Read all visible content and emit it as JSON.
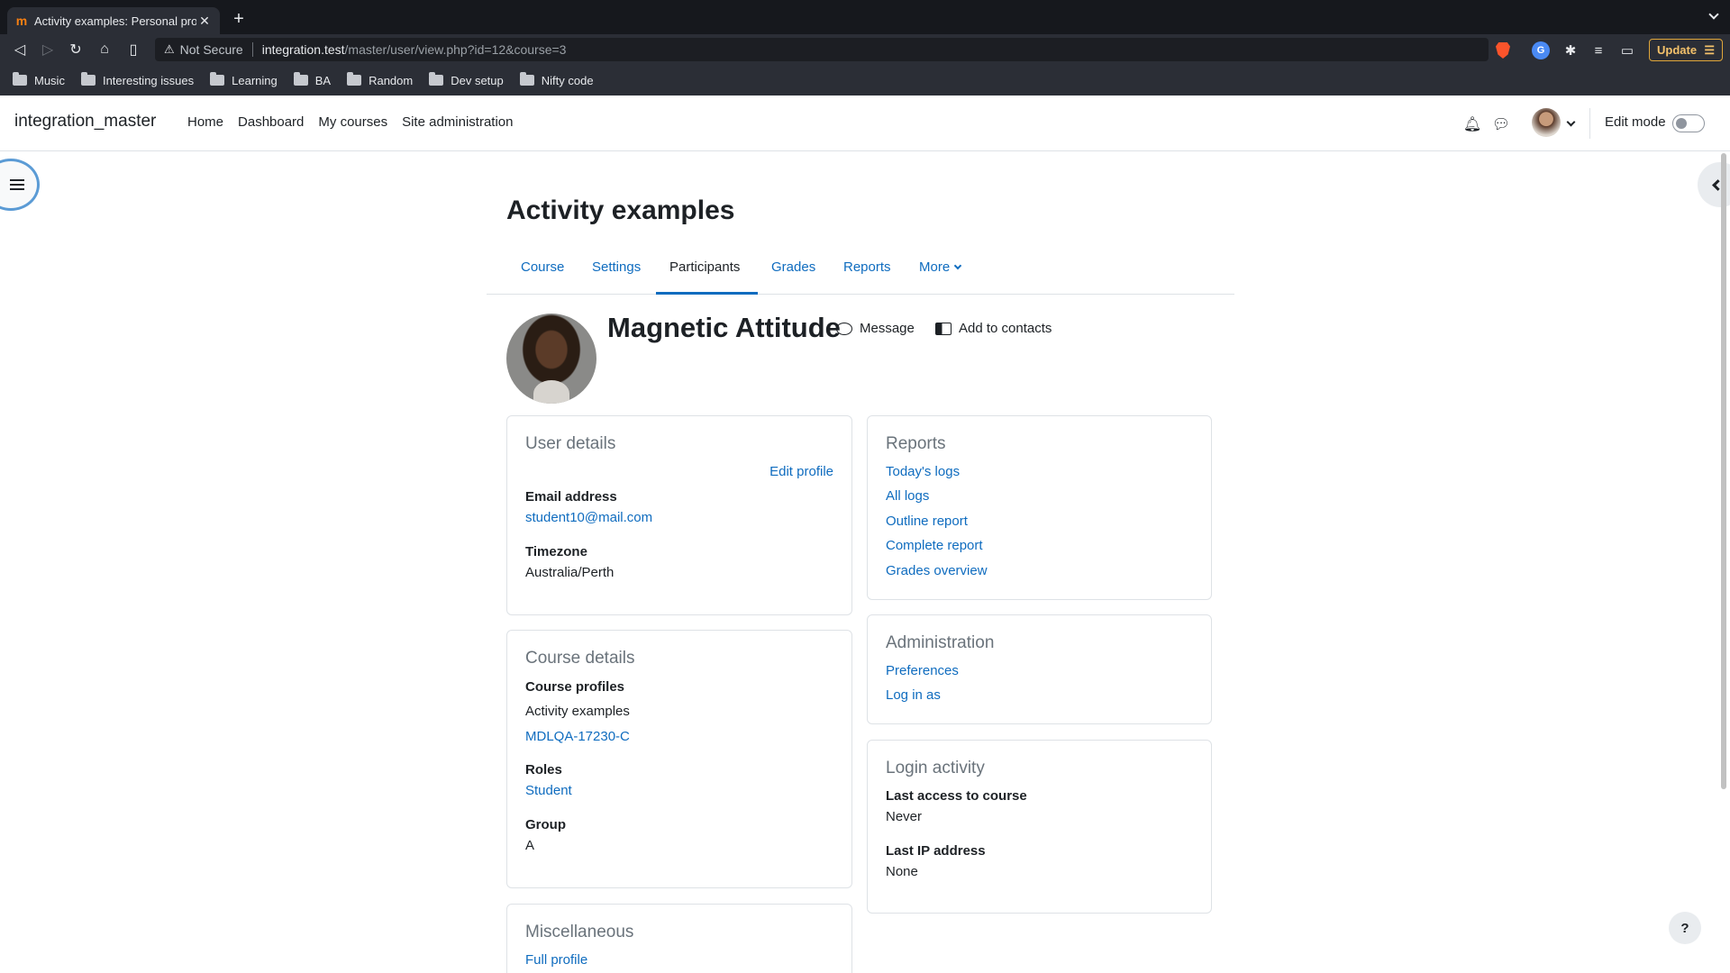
{
  "browser": {
    "tab_title": "Activity examples: Personal pro",
    "tab_favicon": "m",
    "not_secure": "Not Secure",
    "url_host": "integration.test",
    "url_path": "/master/user/view.php?id=12&course=3",
    "update_label": "Update",
    "bookmarks": [
      "Music",
      "Interesting issues",
      "Learning",
      "BA",
      "Random",
      "Dev setup",
      "Nifty code"
    ]
  },
  "site": {
    "brand": "integration_master",
    "nav": [
      "Home",
      "Dashboard",
      "My courses",
      "Site administration"
    ],
    "edit_mode_label": "Edit mode"
  },
  "page": {
    "title": "Activity examples",
    "tabs": [
      "Course",
      "Settings",
      "Participants",
      "Grades",
      "Reports",
      "More"
    ],
    "user_name": "Magnetic Attitude",
    "message_label": "Message",
    "add_contacts_label": "Add to contacts"
  },
  "user_details": {
    "heading": "User details",
    "edit_profile": "Edit profile",
    "email_label": "Email address",
    "email_value": "student10@mail.com",
    "timezone_label": "Timezone",
    "timezone_value": "Australia/Perth"
  },
  "course_details": {
    "heading": "Course details",
    "profiles_label": "Course profiles",
    "profile_1": "Activity examples",
    "profile_2": "MDLQA-17230-C",
    "roles_label": "Roles",
    "roles_value": "Student",
    "group_label": "Group",
    "group_value": "A"
  },
  "misc": {
    "heading": "Miscellaneous",
    "full_profile": "Full profile"
  },
  "reports": {
    "heading": "Reports",
    "links": [
      "Today's logs",
      "All logs",
      "Outline report",
      "Complete report",
      "Grades overview"
    ]
  },
  "administration": {
    "heading": "Administration",
    "links": [
      "Preferences",
      "Log in as"
    ]
  },
  "login_activity": {
    "heading": "Login activity",
    "last_access_label": "Last access to course",
    "last_access_value": "Never",
    "last_ip_label": "Last IP address",
    "last_ip_value": "None"
  },
  "help_label": "?"
}
